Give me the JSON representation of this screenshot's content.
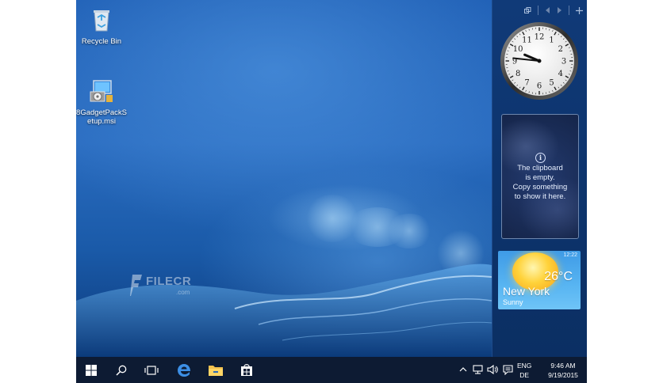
{
  "desktop": {
    "icons": [
      {
        "label": "Recycle Bin",
        "icon": "recycle-bin-icon"
      },
      {
        "label": "8GadgetPackSetup.msi",
        "label_lines": [
          "8GadgetPackS",
          "etup.msi"
        ],
        "icon": "msi-installer-icon"
      }
    ],
    "watermark": {
      "text": "FILECR",
      "sub": ".com"
    }
  },
  "gadget_sidebar": {
    "toolbar": [
      "restore-icon",
      "prev-icon",
      "next-icon",
      "add-icon"
    ],
    "clock": {
      "hour": 9,
      "minute": 46,
      "numerals": [
        "12",
        "1",
        "2",
        "3",
        "4",
        "5",
        "6",
        "7",
        "8",
        "9",
        "10",
        "11"
      ]
    },
    "clipboard": {
      "lines": [
        "The clipboard",
        "is empty.",
        "Copy something",
        "to show it here."
      ]
    },
    "weather": {
      "time": "12:22",
      "temperature": "26°C",
      "city": "New York",
      "condition": "Sunny"
    }
  },
  "taskbar": {
    "buttons": [
      "windows-start-icon",
      "search-icon",
      "task-view-icon",
      "edge-browser-icon",
      "file-explorer-icon",
      "store-icon"
    ],
    "tray": {
      "chevron": "^",
      "language_top": "ENG",
      "language_bottom": "DE"
    },
    "clock": {
      "time": "9:46 AM",
      "date": "9/19/2015"
    }
  },
  "colors": {
    "taskbar": "#0d1b33",
    "desktop": "#1f5fb5",
    "sidebar": "#0d346d",
    "weather": "#58b5f2"
  }
}
